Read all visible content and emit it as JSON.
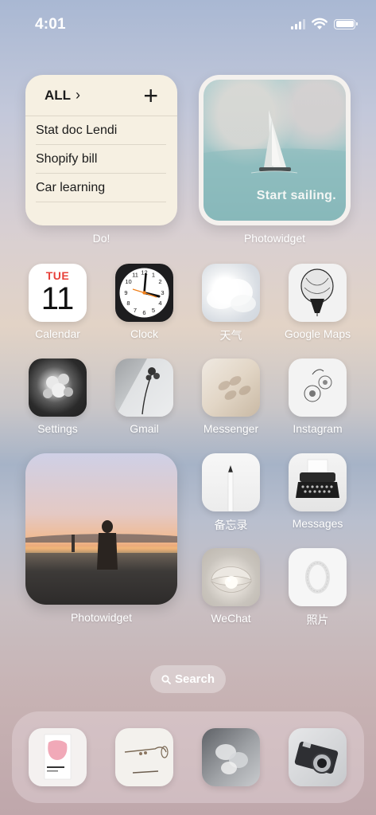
{
  "status_bar": {
    "time": "4:01"
  },
  "do_widget": {
    "header": "ALL",
    "items": [
      "Stat doc Lendi",
      "Shopify bill",
      "Car learning"
    ],
    "label": "Do!"
  },
  "photo_widget_top": {
    "caption": "Start sailing.",
    "label": "Photowidget"
  },
  "apps": {
    "calendar": {
      "label": "Calendar",
      "day": "TUE",
      "date": "11"
    },
    "clock": {
      "label": "Clock"
    },
    "weather": {
      "label": "天气"
    },
    "maps": {
      "label": "Google Maps"
    },
    "settings": {
      "label": "Settings"
    },
    "gmail": {
      "label": "Gmail"
    },
    "messenger": {
      "label": "Messenger"
    },
    "instagram": {
      "label": "Instagram"
    },
    "notes": {
      "label": "备忘录"
    },
    "messages": {
      "label": "Messages"
    },
    "wechat": {
      "label": "WeChat"
    },
    "photos": {
      "label": "照片"
    }
  },
  "photo_widget_bottom": {
    "label": "Photowidget"
  },
  "search": {
    "label": "Search"
  },
  "dock": {
    "apps": [
      "pantone-card-icon",
      "trumpet-sketch-icon",
      "flower-bw-icon",
      "camera-icon"
    ]
  },
  "icons": {
    "calendar": "calendar-icon",
    "clock": "clock-icon",
    "weather": "cloud-icon",
    "maps": "balloon-icon",
    "settings": "flower-icon",
    "gmail": "dried-flower-icon",
    "messenger": "leaf-shadow-icon",
    "instagram": "flower-sketch-icon",
    "notes": "pencil-icon",
    "messages": "typewriter-icon",
    "wechat": "pearl-shell-icon",
    "photos": "oval-frame-icon"
  },
  "colors": {
    "calendar_day": "#e8413a",
    "do_widget_bg": "#f6f0e2"
  }
}
